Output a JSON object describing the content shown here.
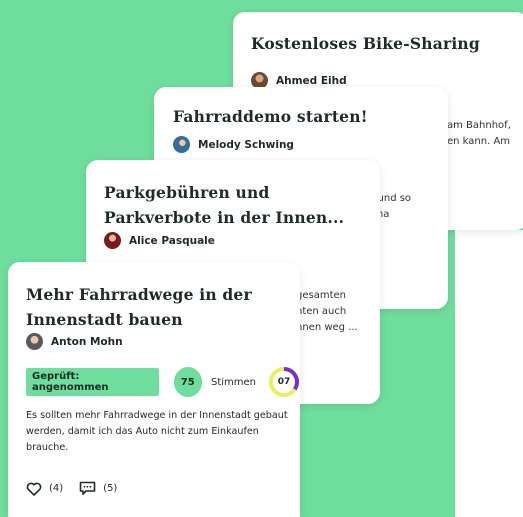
{
  "colors": {
    "accent": "#6fdd9c",
    "ring_purple": "#7b2cd6",
    "ring_yellow": "#e8f060"
  },
  "cards": [
    {
      "title": "Kostenloses Bike-Sharing",
      "author": "Ahmed Eihd",
      "peek_lines": [
        "am Bahnhof,",
        "en kann. Am"
      ]
    },
    {
      "title": "Fahrraddemo starten!",
      "author": "Melody Schwing",
      "peek_lines": [
        "n und so",
        "lima"
      ]
    },
    {
      "title": "Parkgebühren und Parkverbote in der Innen...",
      "author": "Alice Pasquale",
      "peek_lines": [
        "gesamten",
        "nten auch",
        "nnen weg ..."
      ]
    },
    {
      "title": "Mehr Fahrradwege in der Innenstadt bauen",
      "author": "Anton Mohn",
      "status": "Geprüft: angenommen",
      "votes": "75",
      "votes_label": "Stimmen",
      "score": "07",
      "description": "Es sollten mehr Fahrradwege in der Innenstadt gebaut werden, damit ich das Auto nicht zum Einkaufen brauche.",
      "likes": "(4)",
      "comments": "(5)"
    }
  ]
}
